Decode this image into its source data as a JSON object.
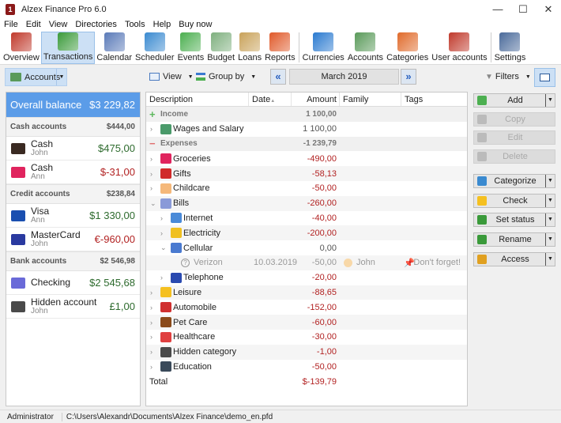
{
  "window": {
    "title": "Alzex Finance Pro 6.0",
    "minimize": "—",
    "maximize": "☐",
    "close": "✕"
  },
  "menu": [
    "File",
    "Edit",
    "View",
    "Directories",
    "Tools",
    "Help",
    "Buy now"
  ],
  "toolbar": [
    {
      "label": "Overview",
      "icon": "overview-icon",
      "color": "#c0392b"
    },
    {
      "label": "Transactions",
      "icon": "transactions-icon",
      "color": "#3a9a3a",
      "active": true
    },
    {
      "label": "Calendar",
      "icon": "calendar-icon",
      "color": "#5a7ab8"
    },
    {
      "label": "Scheduler",
      "icon": "scheduler-icon",
      "color": "#3a8ad0"
    },
    {
      "label": "Events",
      "icon": "events-icon",
      "color": "#4caf50"
    },
    {
      "label": "Budget",
      "icon": "budget-icon",
      "color": "#7fb07f"
    },
    {
      "label": "Loans",
      "icon": "loans-icon",
      "color": "#c9a25a"
    },
    {
      "label": "Reports",
      "icon": "reports-icon",
      "color": "#e05a2a"
    },
    {
      "label": "Currencies",
      "icon": "currencies-icon",
      "color": "#2a7ad0"
    },
    {
      "label": "Accounts",
      "icon": "accounts-icon",
      "color": "#5a9a5a"
    },
    {
      "label": "Categories",
      "icon": "categories-icon",
      "color": "#e06a2a"
    },
    {
      "label": "User accounts",
      "icon": "user-accounts-icon",
      "color": "#c0392b"
    },
    {
      "label": "Settings",
      "icon": "settings-icon",
      "color": "#4a6a9a"
    }
  ],
  "subbar": {
    "accounts_label": "Accounts",
    "view_label": "View",
    "group_by_label": "Group by",
    "prev": "«",
    "month": "March 2019",
    "next": "»",
    "filters_label": "Filters"
  },
  "left_panel": {
    "overall_label": "Overall balance",
    "overall_value": "$3 229,82",
    "groups": [
      {
        "name": "Cash accounts",
        "total": "$444,00",
        "accounts": [
          {
            "name": "Cash",
            "owner": "John",
            "value": "$475,00",
            "sign": "pos",
            "icon": "wallet-icon",
            "color": "#3a2a22"
          },
          {
            "name": "Cash",
            "owner": "Ann",
            "value": "$-31,00",
            "sign": "neg",
            "icon": "purse-icon",
            "color": "#e0245e"
          }
        ]
      },
      {
        "name": "Credit accounts",
        "total": "$238,84",
        "accounts": [
          {
            "name": "Visa",
            "owner": "Ann",
            "value": "$1 330,00",
            "sign": "pos",
            "icon": "visa-card-icon",
            "color": "#1a4fb0"
          },
          {
            "name": "MasterCard",
            "owner": "John",
            "value": "€-960,00",
            "sign": "neg",
            "icon": "mastercard-icon",
            "color": "#2a3aa0"
          }
        ]
      },
      {
        "name": "Bank accounts",
        "total": "$2 546,98",
        "accounts": [
          {
            "name": "Checking",
            "owner": "",
            "value": "$2 545,68",
            "sign": "pos",
            "icon": "check-icon",
            "color": "#6a6ad8"
          },
          {
            "name": "Hidden account",
            "owner": "John",
            "value": "£1,00",
            "sign": "pos",
            "icon": "spy-icon",
            "color": "#4a4a4a"
          }
        ]
      }
    ]
  },
  "grid": {
    "columns": [
      "Description",
      "Date",
      "Amount",
      "Family member",
      "Tags"
    ],
    "sort_indicator": "▲",
    "rows": [
      {
        "type": "section",
        "label": "Income",
        "amount": "1 100,00",
        "marker": "+",
        "markerColor": "#5cb85c"
      },
      {
        "type": "item",
        "level": 0,
        "exp": "›",
        "label": "Wages and Salary",
        "amount": "1 100,00",
        "sign": "plain",
        "icon": "wages-icon",
        "color": "#4a9a6a"
      },
      {
        "type": "section",
        "label": "Expenses",
        "amount": "-1 239,79",
        "marker": "−",
        "markerColor": "#e07070"
      },
      {
        "type": "item",
        "level": 0,
        "exp": "›",
        "label": "Groceries",
        "amount": "-490,00",
        "sign": "neg",
        "icon": "groceries-icon",
        "color": "#e0245e"
      },
      {
        "type": "item",
        "level": 0,
        "exp": "›",
        "label": "Gifts",
        "amount": "-58,13",
        "sign": "neg",
        "icon": "gifts-icon",
        "color": "#d02a2a",
        "alt": true
      },
      {
        "type": "item",
        "level": 0,
        "exp": "›",
        "label": "Childcare",
        "amount": "-50,00",
        "sign": "neg",
        "icon": "childcare-icon",
        "color": "#f5b87a"
      },
      {
        "type": "item",
        "level": 0,
        "exp": "⌄",
        "label": "Bills",
        "amount": "-260,00",
        "sign": "neg",
        "icon": "bills-icon",
        "color": "#8a9ad8",
        "alt": true
      },
      {
        "type": "item",
        "level": 1,
        "exp": "›",
        "label": "Internet",
        "amount": "-40,00",
        "sign": "neg",
        "icon": "internet-icon",
        "color": "#4a8ad8"
      },
      {
        "type": "item",
        "level": 1,
        "exp": "›",
        "label": "Electricity",
        "amount": "-200,00",
        "sign": "neg",
        "icon": "bulb-icon",
        "color": "#f0c020",
        "alt": true
      },
      {
        "type": "item",
        "level": 1,
        "exp": "⌄",
        "label": "Cellular",
        "amount": "0,00",
        "sign": "plain",
        "icon": "phone-icon",
        "color": "#4a7ad0"
      },
      {
        "type": "txn",
        "level": 2,
        "label": "Verizon",
        "date": "10.03.2019",
        "amount": "-50,00",
        "member": "John",
        "tag": "Don't forget!",
        "alt": true
      },
      {
        "type": "item",
        "level": 1,
        "exp": "›",
        "label": "Telephone",
        "amount": "-20,00",
        "sign": "neg",
        "icon": "telephone-icon",
        "color": "#2a4ab0"
      },
      {
        "type": "item",
        "level": 0,
        "exp": "›",
        "label": "Leisure",
        "amount": "-88,65",
        "sign": "neg",
        "icon": "leisure-icon",
        "color": "#f5c020",
        "alt": true
      },
      {
        "type": "item",
        "level": 0,
        "exp": "›",
        "label": "Automobile",
        "amount": "-152,00",
        "sign": "neg",
        "icon": "car-icon",
        "color": "#d03030"
      },
      {
        "type": "item",
        "level": 0,
        "exp": "›",
        "label": "Pet Care",
        "amount": "-60,00",
        "sign": "neg",
        "icon": "pet-icon",
        "color": "#8a4a1a",
        "alt": true
      },
      {
        "type": "item",
        "level": 0,
        "exp": "›",
        "label": "Healthcare",
        "amount": "-30,00",
        "sign": "neg",
        "icon": "healthcare-icon",
        "color": "#e04040"
      },
      {
        "type": "item",
        "level": 0,
        "exp": "›",
        "label": "Hidden category",
        "amount": "-1,00",
        "sign": "neg",
        "icon": "spy-icon",
        "color": "#4a4a4a",
        "alt": true
      },
      {
        "type": "item",
        "level": 0,
        "exp": "›",
        "label": "Education",
        "amount": "-50,00",
        "sign": "neg",
        "icon": "education-icon",
        "color": "#3a4a5a"
      },
      {
        "type": "total",
        "label": "Total",
        "amount": "$-139,79"
      }
    ]
  },
  "actions": [
    {
      "label": "Add",
      "icon": "plus-icon",
      "color": "#4caf50",
      "dropdown": true,
      "disabled": false
    },
    {
      "label": "Copy",
      "icon": "copy-icon",
      "color": "#bbbbbb",
      "dropdown": false,
      "disabled": true
    },
    {
      "label": "Edit",
      "icon": "pencil-icon",
      "color": "#bbbbbb",
      "dropdown": false,
      "disabled": true
    },
    {
      "label": "Delete",
      "icon": "delete-icon",
      "color": "#bbbbbb",
      "dropdown": false,
      "disabled": true
    },
    {
      "label": "Categorize",
      "icon": "categorize-icon",
      "color": "#3a8ad0",
      "dropdown": true,
      "disabled": false
    },
    {
      "label": "Check",
      "icon": "star-icon",
      "color": "#f5c020",
      "dropdown": true,
      "disabled": false
    },
    {
      "label": "Set status",
      "icon": "status-check-icon",
      "color": "#3a9a3a",
      "dropdown": true,
      "disabled": false
    },
    {
      "label": "Rename",
      "icon": "rename-icon",
      "color": "#3a9a3a",
      "dropdown": true,
      "disabled": false
    },
    {
      "label": "Access",
      "icon": "lock-icon",
      "color": "#e0a020",
      "dropdown": true,
      "disabled": false
    }
  ],
  "status": {
    "user": "Administrator",
    "path": "C:\\Users\\Alexandr\\Documents\\Alzex Finance\\demo_en.pfd"
  }
}
